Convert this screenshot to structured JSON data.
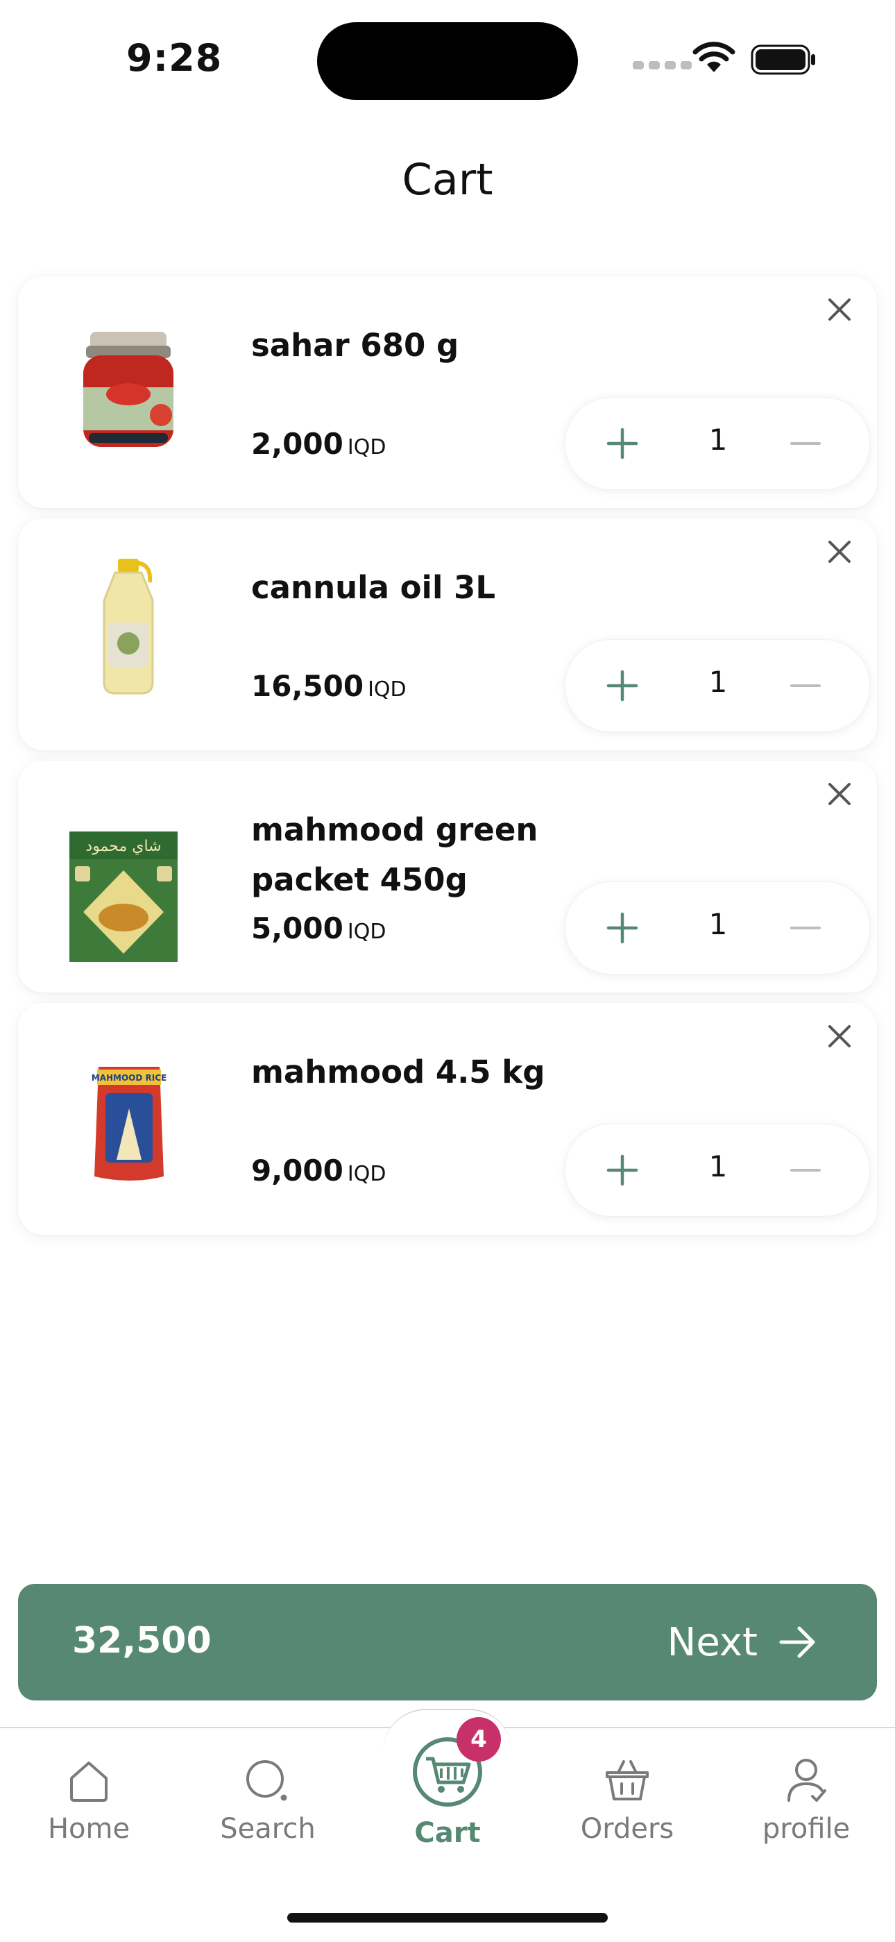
{
  "status_bar": {
    "time": "9:28"
  },
  "header": {
    "title": "Cart"
  },
  "cart": {
    "currency": "IQD",
    "items": [
      {
        "name": "sahar 680 g",
        "price": "2,000",
        "quantity": "1",
        "image_icon": "tomato-paste-jar-image"
      },
      {
        "name": "cannula oil 3L",
        "price": "16,500",
        "quantity": "1",
        "image_icon": "oil-bottle-image"
      },
      {
        "name": "mahmood green packet 450g",
        "price": "5,000",
        "quantity": "1",
        "image_icon": "tea-packet-image",
        "image_text": "شاي محمود"
      },
      {
        "name": "mahmood 4.5 kg",
        "price": "9,000",
        "quantity": "1",
        "image_icon": "rice-bag-image",
        "image_text": "MAHMOOD RICE"
      }
    ]
  },
  "checkout": {
    "total": "32,500",
    "next_label": "Next"
  },
  "bottom_nav": {
    "items": [
      {
        "label": "Home",
        "icon": "home-icon"
      },
      {
        "label": "Search",
        "icon": "search-icon"
      },
      {
        "label": "Cart",
        "icon": "cart-icon",
        "badge": "4",
        "active": true
      },
      {
        "label": "Orders",
        "icon": "basket-icon"
      },
      {
        "label": "profile",
        "icon": "profile-icon"
      }
    ]
  },
  "colors": {
    "accent": "#568874",
    "badge": "#c8306a",
    "text": "#111111",
    "muted": "#7a7a7a"
  }
}
